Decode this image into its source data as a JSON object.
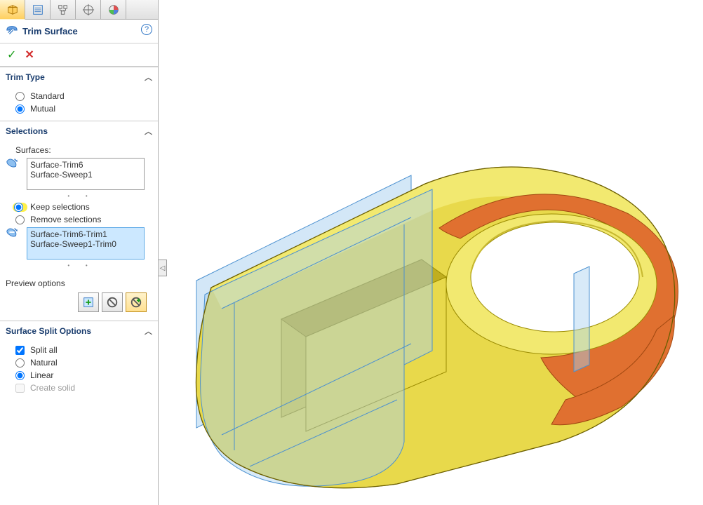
{
  "feature": {
    "title": "Trim Surface"
  },
  "sections": {
    "trimType": {
      "header": "Trim Type",
      "standard": "Standard",
      "mutual": "Mutual"
    },
    "selections": {
      "header": "Selections",
      "surfacesLabel": "Surfaces:",
      "surfaceItems": [
        "Surface-Trim6",
        "Surface-Sweep1"
      ],
      "keep": "Keep selections",
      "remove": "Remove selections",
      "resultItems": [
        "Surface-Trim6-Trim1",
        "Surface-Sweep1-Trim0"
      ]
    },
    "preview": {
      "header": "Preview options"
    },
    "split": {
      "header": "Surface Split Options",
      "splitAll": "Split all",
      "natural": "Natural",
      "linear": "Linear",
      "createSolid": "Create solid"
    }
  }
}
